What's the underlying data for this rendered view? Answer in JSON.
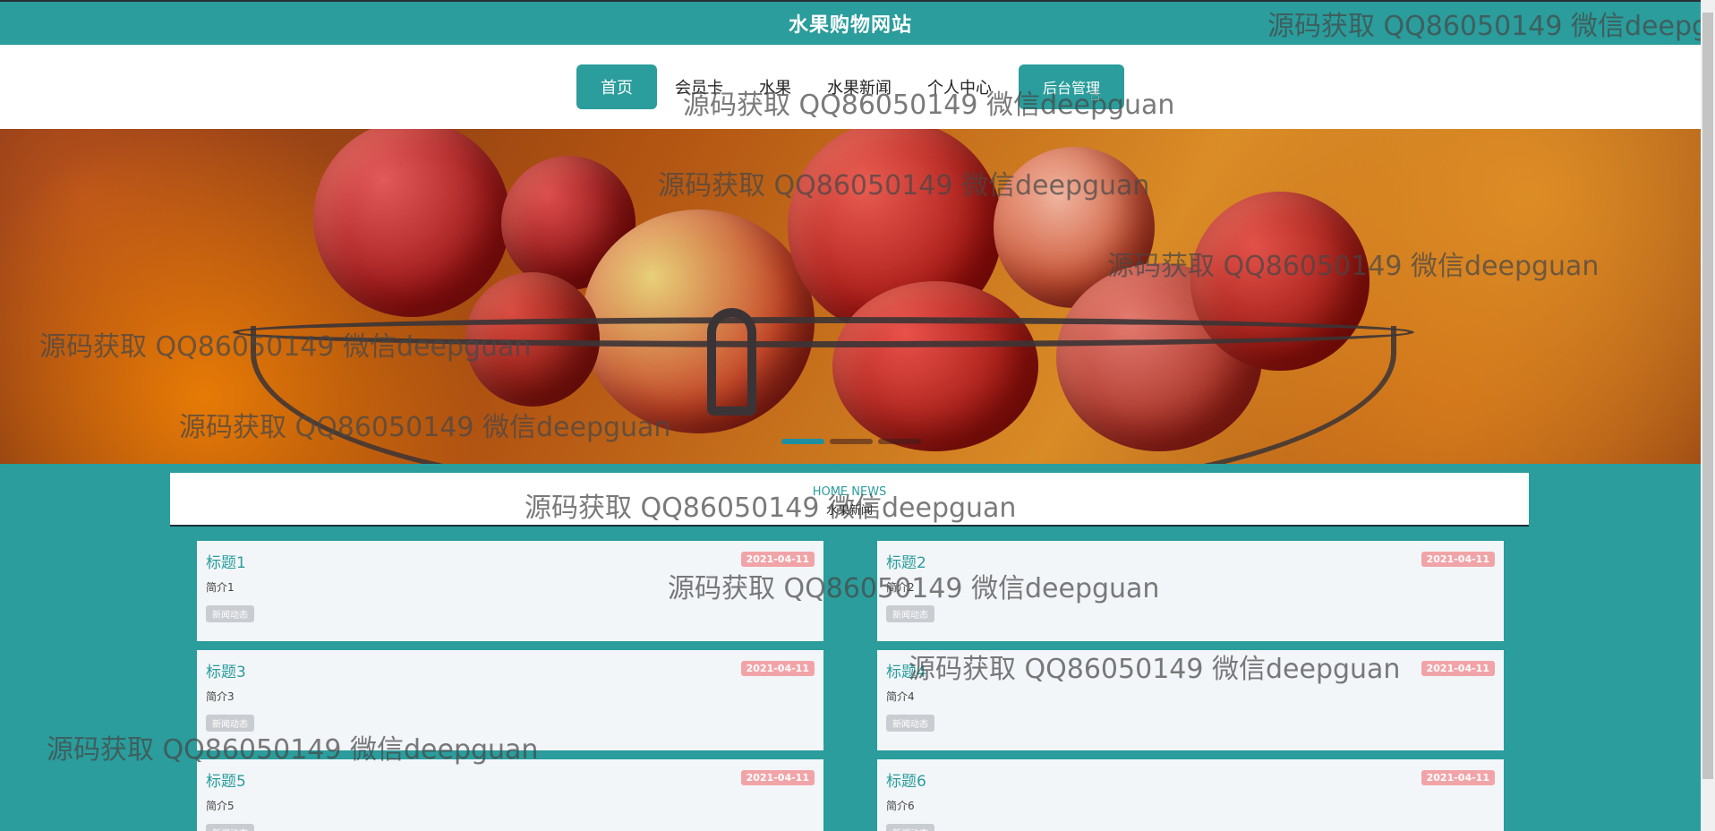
{
  "header": {
    "title": "水果购物网站"
  },
  "nav": {
    "items": [
      "首页",
      "会员卡",
      "水果",
      "水果新闻",
      "个人中心"
    ],
    "admin_label": "后台管理"
  },
  "banner": {
    "slides": 3,
    "active_slide": 1
  },
  "news": {
    "heading_en": "HOME NEWS",
    "heading_cn": "水果新闻",
    "cards": [
      {
        "title": "标题1",
        "summary": "简介1",
        "tag": "新闻动态",
        "date": "2021-04-11"
      },
      {
        "title": "标题2",
        "summary": "简介2",
        "tag": "新闻动态",
        "date": "2021-04-11"
      },
      {
        "title": "标题3",
        "summary": "简介3",
        "tag": "新闻动态",
        "date": "2021-04-11"
      },
      {
        "title": "标题4",
        "summary": "简介4",
        "tag": "新闻动态",
        "date": "2021-04-11"
      },
      {
        "title": "标题5",
        "summary": "简介5",
        "tag": "新闻动态",
        "date": "2021-04-11"
      },
      {
        "title": "标题6",
        "summary": "简介6",
        "tag": "新闻动态",
        "date": "2021-04-11"
      }
    ]
  },
  "watermark": "源码获取 QQ86050149 微信deepguan",
  "colors": {
    "primary": "#2a9d9c",
    "date_badge": "#f1a4a8",
    "card_bg": "#f3f6f9"
  }
}
